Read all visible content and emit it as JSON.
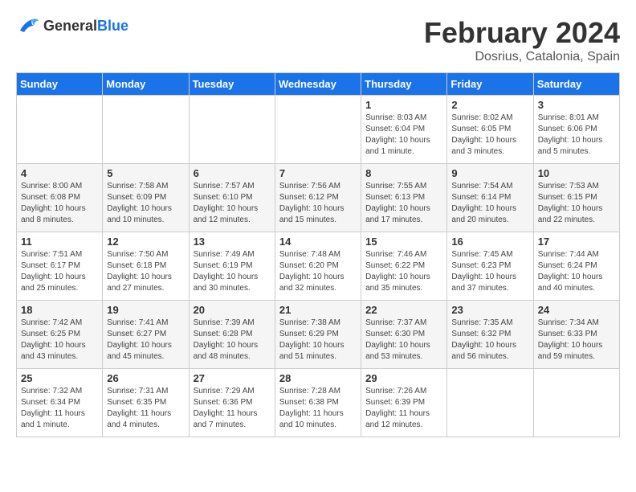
{
  "header": {
    "logo_general": "General",
    "logo_blue": "Blue",
    "title": "February 2024",
    "subtitle": "Dosrius, Catalonia, Spain"
  },
  "days_of_week": [
    "Sunday",
    "Monday",
    "Tuesday",
    "Wednesday",
    "Thursday",
    "Friday",
    "Saturday"
  ],
  "weeks": [
    [
      {
        "day": "",
        "info": ""
      },
      {
        "day": "",
        "info": ""
      },
      {
        "day": "",
        "info": ""
      },
      {
        "day": "",
        "info": ""
      },
      {
        "day": "1",
        "info": "Sunrise: 8:03 AM\nSunset: 6:04 PM\nDaylight: 10 hours and 1 minute."
      },
      {
        "day": "2",
        "info": "Sunrise: 8:02 AM\nSunset: 6:05 PM\nDaylight: 10 hours and 3 minutes."
      },
      {
        "day": "3",
        "info": "Sunrise: 8:01 AM\nSunset: 6:06 PM\nDaylight: 10 hours and 5 minutes."
      }
    ],
    [
      {
        "day": "4",
        "info": "Sunrise: 8:00 AM\nSunset: 6:08 PM\nDaylight: 10 hours and 8 minutes."
      },
      {
        "day": "5",
        "info": "Sunrise: 7:58 AM\nSunset: 6:09 PM\nDaylight: 10 hours and 10 minutes."
      },
      {
        "day": "6",
        "info": "Sunrise: 7:57 AM\nSunset: 6:10 PM\nDaylight: 10 hours and 12 minutes."
      },
      {
        "day": "7",
        "info": "Sunrise: 7:56 AM\nSunset: 6:12 PM\nDaylight: 10 hours and 15 minutes."
      },
      {
        "day": "8",
        "info": "Sunrise: 7:55 AM\nSunset: 6:13 PM\nDaylight: 10 hours and 17 minutes."
      },
      {
        "day": "9",
        "info": "Sunrise: 7:54 AM\nSunset: 6:14 PM\nDaylight: 10 hours and 20 minutes."
      },
      {
        "day": "10",
        "info": "Sunrise: 7:53 AM\nSunset: 6:15 PM\nDaylight: 10 hours and 22 minutes."
      }
    ],
    [
      {
        "day": "11",
        "info": "Sunrise: 7:51 AM\nSunset: 6:17 PM\nDaylight: 10 hours and 25 minutes."
      },
      {
        "day": "12",
        "info": "Sunrise: 7:50 AM\nSunset: 6:18 PM\nDaylight: 10 hours and 27 minutes."
      },
      {
        "day": "13",
        "info": "Sunrise: 7:49 AM\nSunset: 6:19 PM\nDaylight: 10 hours and 30 minutes."
      },
      {
        "day": "14",
        "info": "Sunrise: 7:48 AM\nSunset: 6:20 PM\nDaylight: 10 hours and 32 minutes."
      },
      {
        "day": "15",
        "info": "Sunrise: 7:46 AM\nSunset: 6:22 PM\nDaylight: 10 hours and 35 minutes."
      },
      {
        "day": "16",
        "info": "Sunrise: 7:45 AM\nSunset: 6:23 PM\nDaylight: 10 hours and 37 minutes."
      },
      {
        "day": "17",
        "info": "Sunrise: 7:44 AM\nSunset: 6:24 PM\nDaylight: 10 hours and 40 minutes."
      }
    ],
    [
      {
        "day": "18",
        "info": "Sunrise: 7:42 AM\nSunset: 6:25 PM\nDaylight: 10 hours and 43 minutes."
      },
      {
        "day": "19",
        "info": "Sunrise: 7:41 AM\nSunset: 6:27 PM\nDaylight: 10 hours and 45 minutes."
      },
      {
        "day": "20",
        "info": "Sunrise: 7:39 AM\nSunset: 6:28 PM\nDaylight: 10 hours and 48 minutes."
      },
      {
        "day": "21",
        "info": "Sunrise: 7:38 AM\nSunset: 6:29 PM\nDaylight: 10 hours and 51 minutes."
      },
      {
        "day": "22",
        "info": "Sunrise: 7:37 AM\nSunset: 6:30 PM\nDaylight: 10 hours and 53 minutes."
      },
      {
        "day": "23",
        "info": "Sunrise: 7:35 AM\nSunset: 6:32 PM\nDaylight: 10 hours and 56 minutes."
      },
      {
        "day": "24",
        "info": "Sunrise: 7:34 AM\nSunset: 6:33 PM\nDaylight: 10 hours and 59 minutes."
      }
    ],
    [
      {
        "day": "25",
        "info": "Sunrise: 7:32 AM\nSunset: 6:34 PM\nDaylight: 11 hours and 1 minute."
      },
      {
        "day": "26",
        "info": "Sunrise: 7:31 AM\nSunset: 6:35 PM\nDaylight: 11 hours and 4 minutes."
      },
      {
        "day": "27",
        "info": "Sunrise: 7:29 AM\nSunset: 6:36 PM\nDaylight: 11 hours and 7 minutes."
      },
      {
        "day": "28",
        "info": "Sunrise: 7:28 AM\nSunset: 6:38 PM\nDaylight: 11 hours and 10 minutes."
      },
      {
        "day": "29",
        "info": "Sunrise: 7:26 AM\nSunset: 6:39 PM\nDaylight: 11 hours and 12 minutes."
      },
      {
        "day": "",
        "info": ""
      },
      {
        "day": "",
        "info": ""
      }
    ]
  ]
}
